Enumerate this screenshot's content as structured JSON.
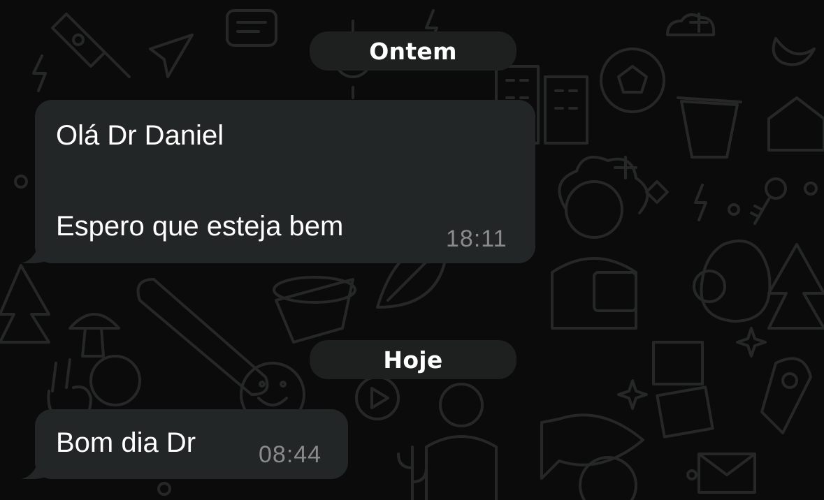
{
  "chat": {
    "date_separators": [
      {
        "label": "Ontem"
      },
      {
        "label": "Hoje"
      }
    ],
    "messages": [
      {
        "line1": "Olá Dr Daniel",
        "line2": "Espero que esteja bem",
        "time": "18:11"
      },
      {
        "line1": "Bom dia Dr",
        "time": "08:44"
      }
    ]
  },
  "colors": {
    "background": "#0b0b0b",
    "bubble_incoming": "#232626",
    "date_pill": "#1e1f1f",
    "timestamp": "#8a8c8c",
    "doodle_stroke": "#262727"
  }
}
